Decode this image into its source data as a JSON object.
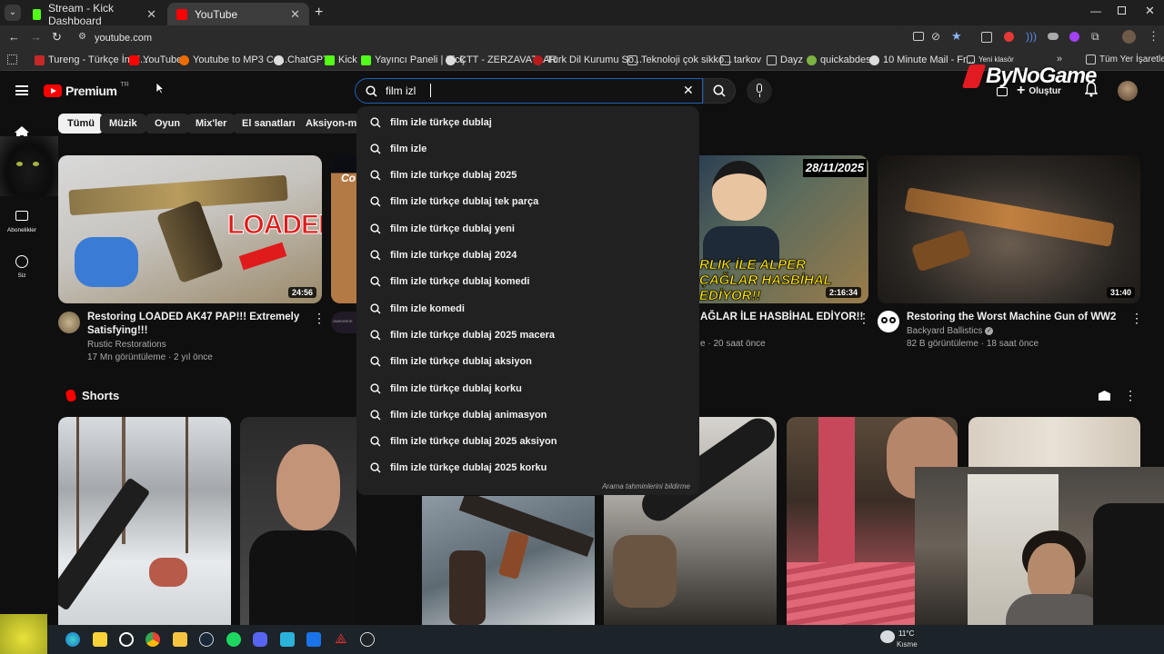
{
  "browser": {
    "tabs": [
      {
        "title": "Stream - Kick Dashboard",
        "active": false
      },
      {
        "title": "YouTube",
        "active": true
      }
    ],
    "url": "youtube.com",
    "bookmarks": [
      "Tureng - Türkçe İngil...",
      "YouTube",
      "Youtube to MP3 Co...",
      "ChatGPT",
      "Kick",
      "Yayıncı Paneli | Kick",
      "ÇTT - ZERZAVATLAR",
      "Türk Dil Kurumu Sö...",
      "Teknoloji çok sikko...",
      "tarkov",
      "Dayz",
      "quickabdest",
      "10 Minute Mail - Fr...",
      "Yeni klasör",
      "Tüm Yer İşaretleri"
    ]
  },
  "youtube": {
    "logo_text": "Premium",
    "logo_badge": "TR",
    "search": {
      "value": "film izl"
    },
    "create_label": "Oluştur",
    "sidebar": [
      {
        "icon": "home-icon",
        "label": ""
      },
      {
        "icon": "subscriptions-icon",
        "label": "Abonelikler"
      },
      {
        "icon": "you-icon",
        "label": "Siz"
      }
    ],
    "chips": [
      "Tümü",
      "Müzik",
      "Oyun",
      "Mix'ler",
      "El sanatları",
      "Aksiyon-mac"
    ],
    "suggestions": [
      "film izle türkçe dublaj",
      "film izle",
      "film izle türkçe dublaj 2025",
      "film izle türkçe dublaj tek parça",
      "film izle türkçe dublaj yeni",
      "film izle türkçe dublaj 2024",
      "film izle türkçe dublaj komedi",
      "film izle komedi",
      "film izle türkçe dublaj 2025 macera",
      "film izle türkçe dublaj aksiyon",
      "film izle türkçe dublaj korku",
      "film izle türkçe dublaj animasyon",
      "film izle türkçe dublaj 2025 aksiyon",
      "film izle türkçe dublaj 2025 korku"
    ],
    "suggest_report": "Arama tahminlerini bildirme",
    "videos": [
      {
        "title": "Restoring LOADED AK47 PAP!!! Extremely Satisfying!!!",
        "channel": "Rustic Restorations",
        "meta": "17 Mn görüntüleme · 2 yıl önce",
        "duration": "24:56",
        "thumb_text": "LOADED"
      },
      {
        "title": "AĞLAR İLE HASBİHAL EDİYOR!!",
        "channel": "",
        "meta": "e · 20 saat önce",
        "duration": "2:16:34",
        "thumb_text": "28/11/2025",
        "thumb_caption": "RLIK İLE ALPER ÇAĞLAR HASBİHAL EDİYOR!!"
      },
      {
        "title": "Restoring the Worst Machine Gun of WW2",
        "channel": "Backyard Ballistics",
        "meta": "82 B görüntüleme · 18 saat önce",
        "duration": "31:40"
      }
    ],
    "shorts_title": "Shorts",
    "stream_overlay": "ByNoGame",
    "partial_channel": "Co",
    "partial_channel_avatar": "OMEGREIS"
  },
  "taskbar": {
    "weather_temp": "11°C",
    "weather_text": "Kısme"
  },
  "colors": {
    "yt_red": "#ff0000",
    "bg": "#0f0f0f",
    "dropdown": "#212121",
    "kick_green": "#53fc18"
  }
}
